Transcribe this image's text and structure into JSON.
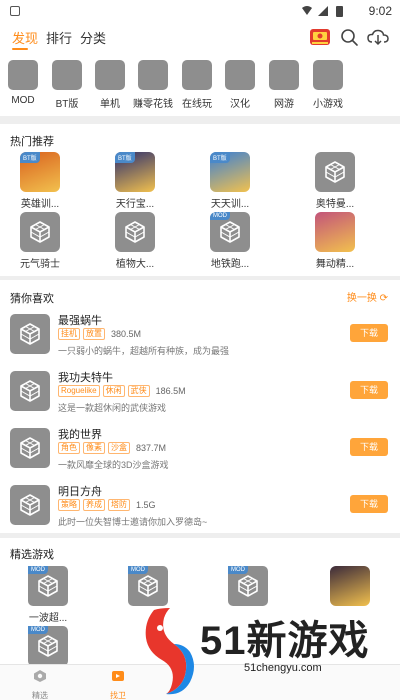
{
  "status_bar": {
    "time": "9:02"
  },
  "top_tabs": [
    {
      "label": "发现"
    },
    {
      "label": "排行"
    },
    {
      "label": "分类"
    }
  ],
  "top_icons": [
    "gift-icon",
    "search-icon",
    "download-cloud-icon"
  ],
  "categories": [
    {
      "label": "MOD"
    },
    {
      "label": "BT版"
    },
    {
      "label": "单机"
    },
    {
      "label": "赚零花钱"
    },
    {
      "label": "在线玩"
    },
    {
      "label": "汉化"
    },
    {
      "label": "网游"
    },
    {
      "label": "小游戏"
    }
  ],
  "hot": {
    "title": "热门推荐",
    "items": [
      {
        "label": "英雄训...",
        "badge": "BT版",
        "kind": "art",
        "color": "#d9621f"
      },
      {
        "label": "天行宝...",
        "badge": "BT版",
        "kind": "art",
        "color": "#2c2e6e"
      },
      {
        "label": "天天训...",
        "badge": "BT版",
        "kind": "art",
        "color": "#3a7fd5"
      },
      {
        "label": "奥特曼...",
        "badge": "",
        "kind": "placeholder"
      },
      {
        "label": "元气骑士",
        "badge": "",
        "kind": "placeholder"
      },
      {
        "label": "植物大...",
        "badge": "",
        "kind": "placeholder"
      },
      {
        "label": "地铁跑...",
        "badge": "MOD",
        "kind": "placeholder"
      },
      {
        "label": "舞动精...",
        "badge": "",
        "kind": "art",
        "color": "#c2547a"
      }
    ]
  },
  "guess": {
    "title": "猜你喜欢",
    "refresh_label": "换一换",
    "download_label": "下载",
    "games": [
      {
        "name": "最强蜗牛",
        "tags": [
          "挂机",
          "放置"
        ],
        "size": "380.5M",
        "desc": "一只弱小的蜗牛，超越所有种族，成为最强"
      },
      {
        "name": "我功夫特牛",
        "tags": [
          "Roguelike",
          "休闲",
          "武侠"
        ],
        "size": "186.5M",
        "desc": "这是一款超休闲的武侠游戏"
      },
      {
        "name": "我的世界",
        "tags": [
          "角色",
          "像素",
          "沙盒"
        ],
        "size": "837.7M",
        "desc": "一款风靡全球的3D沙盒游戏"
      },
      {
        "name": "明日方舟",
        "tags": [
          "策略",
          "养成",
          "塔防"
        ],
        "size": "1.5G",
        "desc": "此时一位失智博士邀请你加入罗德岛~"
      }
    ]
  },
  "selected": {
    "title": "精选游戏",
    "items": [
      {
        "label": "一波超...",
        "badge": "MOD",
        "kind": "placeholder"
      },
      {
        "label": "",
        "badge": "MOD",
        "kind": "placeholder"
      },
      {
        "label": "",
        "badge": "MOD",
        "kind": "placeholder"
      },
      {
        "label": "",
        "badge": "",
        "kind": "art",
        "color": "#3b2a3a"
      },
      {
        "label": "",
        "badge": "MOD",
        "kind": "placeholder"
      }
    ]
  },
  "bottom_nav": [
    {
      "label": "精选",
      "icon": "home-icon"
    },
    {
      "label": "找卫",
      "icon": "game-icon"
    }
  ],
  "watermark": {
    "brand": "51新游戏",
    "url": "51chengyu.com"
  },
  "colors": {
    "accent": "#ff8c1a",
    "placeholder": "#8e8e8e",
    "mod_badge": "#4a89c9",
    "watermark_red": "#e8362c",
    "watermark_blue": "#1e88e5"
  }
}
